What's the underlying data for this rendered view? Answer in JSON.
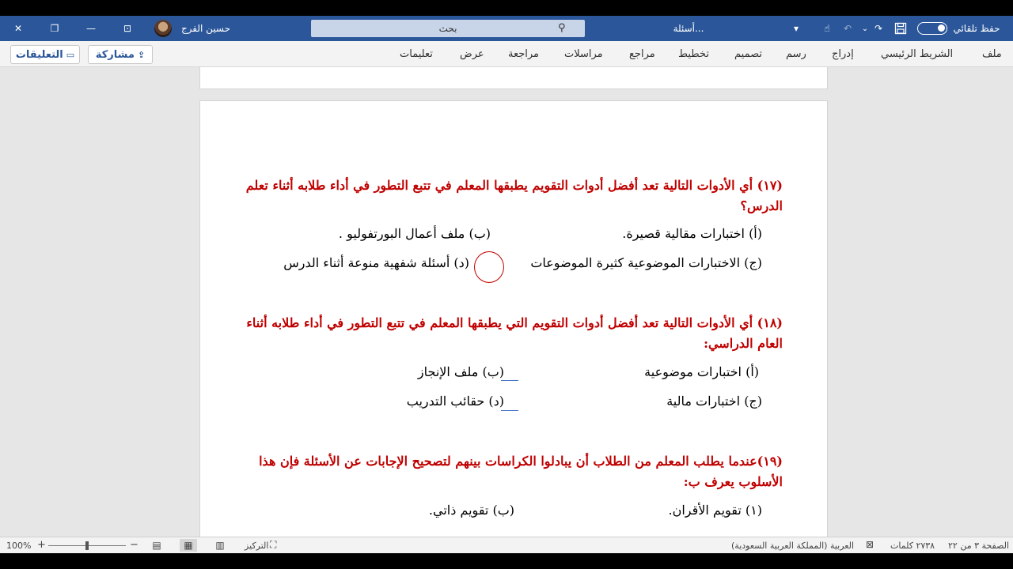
{
  "titlebar": {
    "autosave_label": "حفظ تلقائي",
    "doc_title": "أسئلة...",
    "dropdown_glyph": "⌄",
    "search_placeholder": "بحث",
    "user_name": "حسين الفرج",
    "min_glyph": "—",
    "restore_glyph": "❐",
    "close_glyph": "✕",
    "ribbon_display_glyph": "⊡"
  },
  "ribbon": {
    "tabs": [
      "ملف",
      "الشريط الرئيسي",
      "إدراج",
      "رسم",
      "تصميم",
      "تخطيط",
      "مراجع",
      "مراسلات",
      "مراجعة",
      "عرض",
      "تعليمات"
    ],
    "share_label": "مشاركة",
    "comments_label": "التعليقات"
  },
  "document": {
    "questions": [
      {
        "text": "(١٧) أي الأدوات التالية تعد أفضل أدوات التقويم يطبقها المعلم في تتبع التطور في أداء طلابه أثناء تعلم الدرس؟",
        "options": {
          "a": "(أ) اختبارات مقالية قصيرة.",
          "b": "(ب) ملف أعمال البورتفوليو .",
          "c": "(ج) الاختبارات الموضوعية كثيرة الموضوعات",
          "d": "(د) أسئلة شفهية منوعة أثناء الدرس"
        }
      },
      {
        "text": "(١٨) أي الأدوات التالية تعد أفضل أدوات التقويم التي يطبقها المعلم في تتبع التطور في أداء طلابه أثناء العام الدراسي:",
        "options": {
          "a": "(أ) اختبارات موضوعية",
          "b": "(ب) ملف الإنجاز",
          "c": "(ج) اختبارات مالية",
          "d": "(د) حقائب التدريب"
        }
      },
      {
        "text": "(١٩)عندما يطلب المعلم من الطلاب أن يبادلوا الكراسات بينهم لتصحيح الإجابات عن الأسئلة فإن هذا الأسلوب يعرف ب:",
        "options": {
          "a": "(١) تقويم الأقران.",
          "b": "(ب) تقويم ذاتي."
        }
      }
    ]
  },
  "statusbar": {
    "page_info": "الصفحة ٣ من ٢٢",
    "word_count": "٢٧٣٨ كلمات",
    "language": "العربية (المملكة العربية السعودية)",
    "focus_label": "التركيز",
    "zoom_level": "100%",
    "zoom_minus": "−",
    "zoom_plus": "+",
    "zoom_fraction": 0.5
  }
}
